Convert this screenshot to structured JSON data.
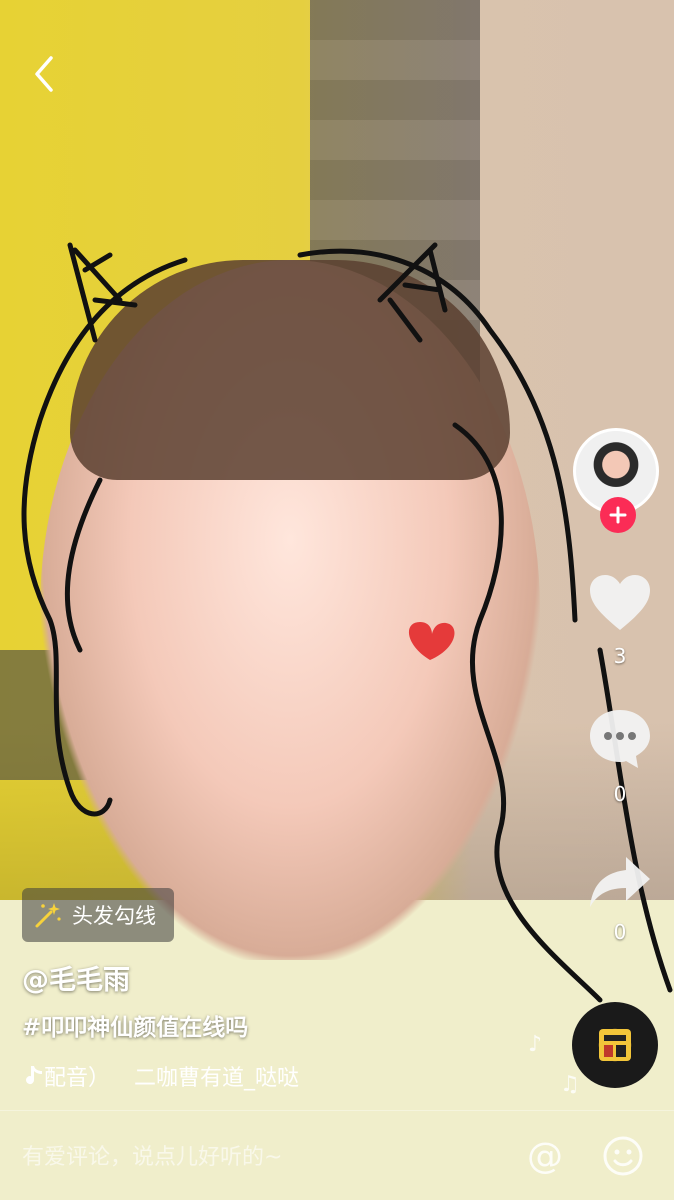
{
  "header": {
    "back_icon": "chevron-left-icon"
  },
  "rail": {
    "like_count": "3",
    "comment_count": "0",
    "share_count": "0",
    "follow_color": "#fb2c56"
  },
  "effect": {
    "label": "头发勾线",
    "icon": "magic-wand-icon"
  },
  "post": {
    "author": "@毛毛雨",
    "caption": "#叩叩神仙颜值在线吗",
    "music_parts": [
      "配音）",
      "二咖曹有道_哒哒"
    ]
  },
  "comment_bar": {
    "placeholder": "有爱评论，说点儿好听的~",
    "at_symbol": "@"
  }
}
